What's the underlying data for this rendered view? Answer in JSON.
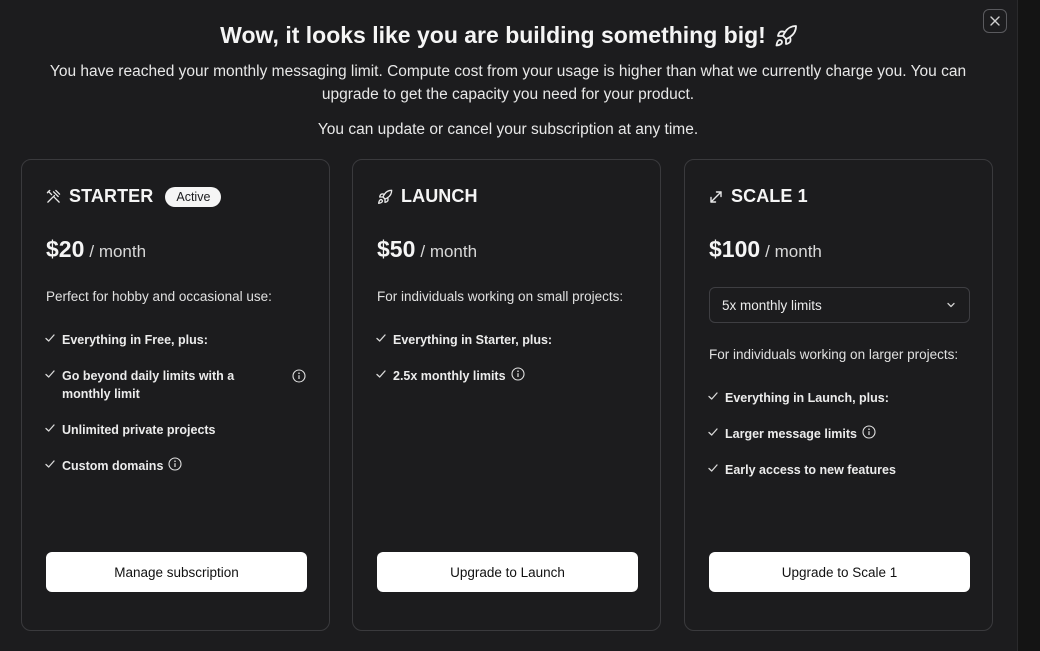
{
  "header": {
    "title": "Wow, it looks like you are building something big!",
    "title_icon": "rocket-icon",
    "message": "You have reached your monthly messaging limit. Compute cost from your usage is higher than what we currently charge you. You can upgrade to get the capacity you need for your product.",
    "note": "You can update or cancel your subscription at any time.",
    "close_icon": "close-icon"
  },
  "plans": [
    {
      "icon": "tools-icon",
      "name": "STARTER",
      "badge": "Active",
      "price": "$20",
      "period": "/ month",
      "description": "Perfect for hobby and occasional use:",
      "features": [
        {
          "text": "Everything in Free, plus:",
          "info": false
        },
        {
          "text": "Go beyond daily limits with a monthly limit",
          "info": true
        },
        {
          "text": "Unlimited private projects",
          "info": false
        },
        {
          "text": "Custom domains",
          "info": true
        }
      ],
      "cta": "Manage subscription"
    },
    {
      "icon": "rocket-icon",
      "name": "LAUNCH",
      "price": "$50",
      "period": "/ month",
      "description": "For individuals working on small projects:",
      "features": [
        {
          "text": "Everything in Starter, plus:",
          "info": false
        },
        {
          "text": "2.5x monthly limits",
          "info": true
        }
      ],
      "cta": "Upgrade to Launch"
    },
    {
      "icon": "expand-arrows-icon",
      "name": "SCALE 1",
      "price": "$100",
      "period": "/ month",
      "select_value": "5x monthly limits",
      "description": "For individuals working on larger projects:",
      "features": [
        {
          "text": "Everything in Launch, plus:",
          "info": false
        },
        {
          "text": "Larger message limits",
          "info": true
        },
        {
          "text": "Early access to new features",
          "info": false
        }
      ],
      "cta": "Upgrade to Scale 1"
    }
  ]
}
